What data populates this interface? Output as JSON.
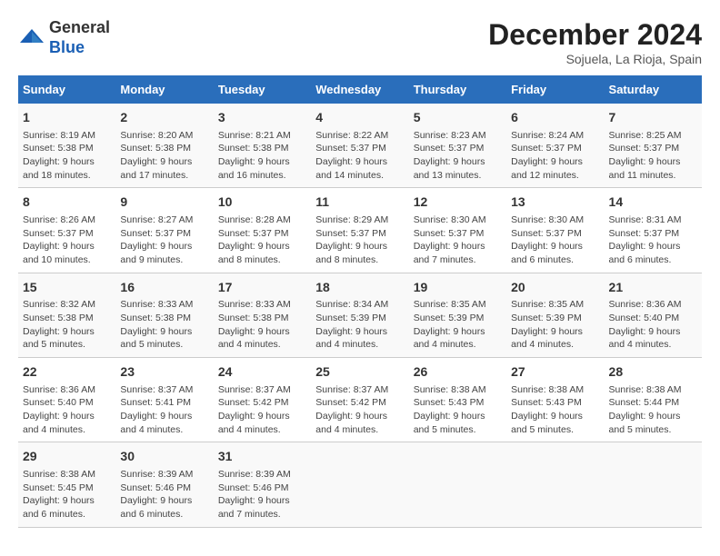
{
  "header": {
    "logo_general": "General",
    "logo_blue": "Blue",
    "month_title": "December 2024",
    "location": "Sojuela, La Rioja, Spain"
  },
  "weekdays": [
    "Sunday",
    "Monday",
    "Tuesday",
    "Wednesday",
    "Thursday",
    "Friday",
    "Saturday"
  ],
  "weeks": [
    [
      {
        "day": "1",
        "sunrise": "8:19 AM",
        "sunset": "5:38 PM",
        "daylight": "9 hours and 18 minutes."
      },
      {
        "day": "2",
        "sunrise": "8:20 AM",
        "sunset": "5:38 PM",
        "daylight": "9 hours and 17 minutes."
      },
      {
        "day": "3",
        "sunrise": "8:21 AM",
        "sunset": "5:38 PM",
        "daylight": "9 hours and 16 minutes."
      },
      {
        "day": "4",
        "sunrise": "8:22 AM",
        "sunset": "5:37 PM",
        "daylight": "9 hours and 14 minutes."
      },
      {
        "day": "5",
        "sunrise": "8:23 AM",
        "sunset": "5:37 PM",
        "daylight": "9 hours and 13 minutes."
      },
      {
        "day": "6",
        "sunrise": "8:24 AM",
        "sunset": "5:37 PM",
        "daylight": "9 hours and 12 minutes."
      },
      {
        "day": "7",
        "sunrise": "8:25 AM",
        "sunset": "5:37 PM",
        "daylight": "9 hours and 11 minutes."
      }
    ],
    [
      {
        "day": "8",
        "sunrise": "8:26 AM",
        "sunset": "5:37 PM",
        "daylight": "9 hours and 10 minutes."
      },
      {
        "day": "9",
        "sunrise": "8:27 AM",
        "sunset": "5:37 PM",
        "daylight": "9 hours and 9 minutes."
      },
      {
        "day": "10",
        "sunrise": "8:28 AM",
        "sunset": "5:37 PM",
        "daylight": "9 hours and 8 minutes."
      },
      {
        "day": "11",
        "sunrise": "8:29 AM",
        "sunset": "5:37 PM",
        "daylight": "9 hours and 8 minutes."
      },
      {
        "day": "12",
        "sunrise": "8:30 AM",
        "sunset": "5:37 PM",
        "daylight": "9 hours and 7 minutes."
      },
      {
        "day": "13",
        "sunrise": "8:30 AM",
        "sunset": "5:37 PM",
        "daylight": "9 hours and 6 minutes."
      },
      {
        "day": "14",
        "sunrise": "8:31 AM",
        "sunset": "5:37 PM",
        "daylight": "9 hours and 6 minutes."
      }
    ],
    [
      {
        "day": "15",
        "sunrise": "8:32 AM",
        "sunset": "5:38 PM",
        "daylight": "9 hours and 5 minutes."
      },
      {
        "day": "16",
        "sunrise": "8:33 AM",
        "sunset": "5:38 PM",
        "daylight": "9 hours and 5 minutes."
      },
      {
        "day": "17",
        "sunrise": "8:33 AM",
        "sunset": "5:38 PM",
        "daylight": "9 hours and 4 minutes."
      },
      {
        "day": "18",
        "sunrise": "8:34 AM",
        "sunset": "5:39 PM",
        "daylight": "9 hours and 4 minutes."
      },
      {
        "day": "19",
        "sunrise": "8:35 AM",
        "sunset": "5:39 PM",
        "daylight": "9 hours and 4 minutes."
      },
      {
        "day": "20",
        "sunrise": "8:35 AM",
        "sunset": "5:39 PM",
        "daylight": "9 hours and 4 minutes."
      },
      {
        "day": "21",
        "sunrise": "8:36 AM",
        "sunset": "5:40 PM",
        "daylight": "9 hours and 4 minutes."
      }
    ],
    [
      {
        "day": "22",
        "sunrise": "8:36 AM",
        "sunset": "5:40 PM",
        "daylight": "9 hours and 4 minutes."
      },
      {
        "day": "23",
        "sunrise": "8:37 AM",
        "sunset": "5:41 PM",
        "daylight": "9 hours and 4 minutes."
      },
      {
        "day": "24",
        "sunrise": "8:37 AM",
        "sunset": "5:42 PM",
        "daylight": "9 hours and 4 minutes."
      },
      {
        "day": "25",
        "sunrise": "8:37 AM",
        "sunset": "5:42 PM",
        "daylight": "9 hours and 4 minutes."
      },
      {
        "day": "26",
        "sunrise": "8:38 AM",
        "sunset": "5:43 PM",
        "daylight": "9 hours and 5 minutes."
      },
      {
        "day": "27",
        "sunrise": "8:38 AM",
        "sunset": "5:43 PM",
        "daylight": "9 hours and 5 minutes."
      },
      {
        "day": "28",
        "sunrise": "8:38 AM",
        "sunset": "5:44 PM",
        "daylight": "9 hours and 5 minutes."
      }
    ],
    [
      {
        "day": "29",
        "sunrise": "8:38 AM",
        "sunset": "5:45 PM",
        "daylight": "9 hours and 6 minutes."
      },
      {
        "day": "30",
        "sunrise": "8:39 AM",
        "sunset": "5:46 PM",
        "daylight": "9 hours and 6 minutes."
      },
      {
        "day": "31",
        "sunrise": "8:39 AM",
        "sunset": "5:46 PM",
        "daylight": "9 hours and 7 minutes."
      },
      null,
      null,
      null,
      null
    ]
  ],
  "labels": {
    "sunrise": "Sunrise:",
    "sunset": "Sunset:",
    "daylight": "Daylight:"
  }
}
